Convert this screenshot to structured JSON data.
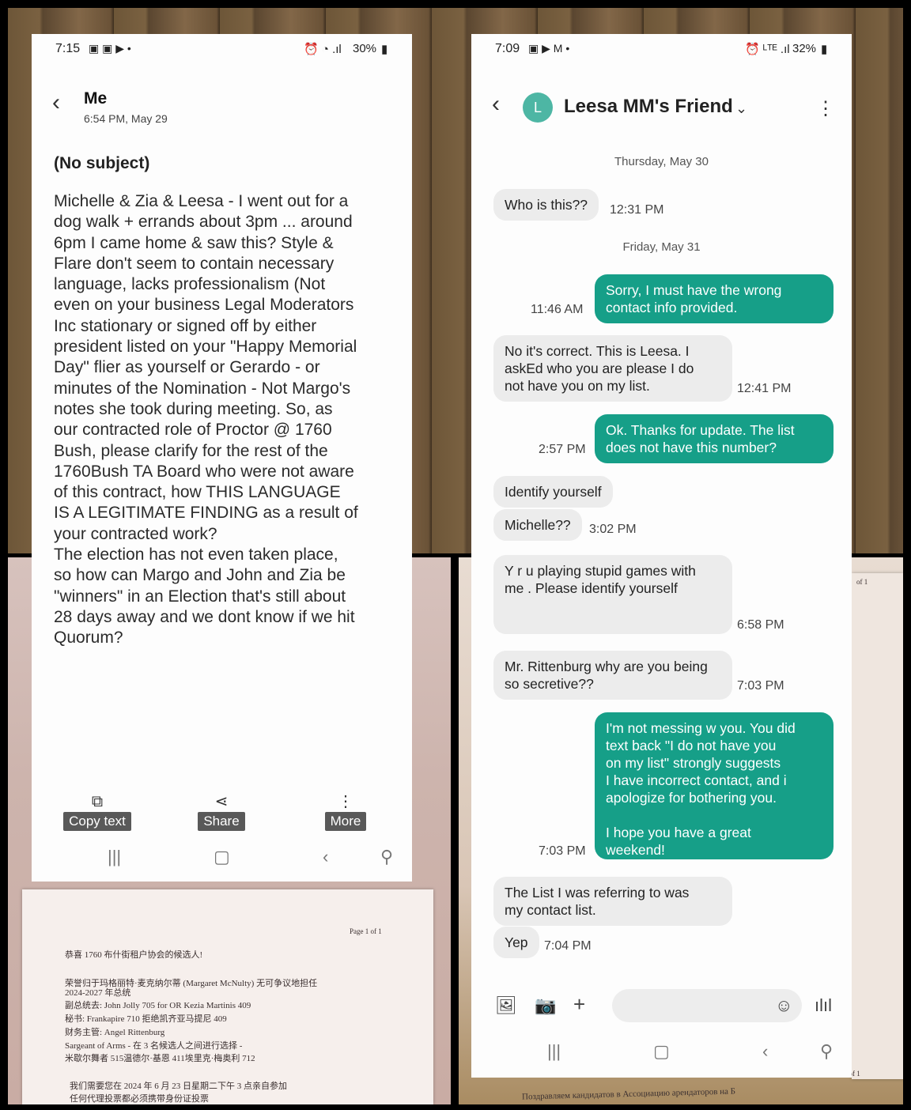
{
  "left_screen": {
    "status": {
      "time": "7:15",
      "battery": "30%"
    },
    "header": {
      "title": "Me",
      "date": "6:54 PM, May 29"
    },
    "subject": "(No subject)",
    "body": "Michelle & Zia & Leesa - I went out for a\ndog walk + errands about 3pm ... around\n6pm I came home & saw this? Style &\nFlare don't seem to contain necessary\nlanguage, lacks professionalism (Not\neven on your business Legal Moderators\nInc stationary or signed off  by either\npresident listed on your \"Happy Memorial\nDay\" flier as yourself or Gerardo - or\nminutes of the Nomination - Not Margo's\nnotes she took during meeting. So, as\nour contracted role of Proctor @ 1760\nBush, please clarify for the rest of the\n1760Bush TA Board who were not aware\nof this contract, how THIS LANGUAGE\nIS A LEGITIMATE FINDING as a result of\nyour contracted work?\nThe election has not even taken place,\nso how can Margo and John and Zia be\n\"winners\" in an Election that's still about\n28 days away and we dont know if we hit\nQuorum?",
    "actions": {
      "copy": "Copy text",
      "share": "Share",
      "more": "More"
    }
  },
  "right_screen": {
    "status": {
      "time": "7:09",
      "battery": "32%"
    },
    "header": {
      "avatar_letter": "L",
      "contact_name": "Leesa MM's Friend"
    },
    "day_separators": {
      "thu": "Thursday, May 30",
      "fri": "Friday, May 31"
    },
    "messages": [
      {
        "dir": "in",
        "text": "Who is this??",
        "time": "12:31 PM"
      },
      {
        "dir": "out",
        "text": "Sorry, I must have the wrong\ncontact info provided.",
        "time": "11:46 AM"
      },
      {
        "dir": "in",
        "text": "No it's correct. This is Leesa. I\naskEd who you are please I do\nnot have you on my list.",
        "time": "12:41 PM"
      },
      {
        "dir": "out",
        "text": "Ok. Thanks for update. The list\ndoes not have this number?",
        "time": "2:57 PM"
      },
      {
        "dir": "in",
        "text": "Identify yourself",
        "time": ""
      },
      {
        "dir": "in",
        "text": "Michelle??",
        "time": "3:02 PM"
      },
      {
        "dir": "in",
        "text": "Y r u playing stupid games with\nme . Please identify yourself",
        "time": "6:58 PM"
      },
      {
        "dir": "in",
        "text": "Mr. Rittenburg why are you being\nso secretive??",
        "time": "7:03 PM"
      },
      {
        "dir": "out",
        "text": "I'm not messing w you. You did\ntext back \"I do not have you\non my list\" strongly suggests\nI have incorrect contact, and i\napologize for bothering you.\n\nI hope you have a great\nweekend!",
        "time": "7:03 PM"
      },
      {
        "dir": "in",
        "text": "The List I was referring to was\nmy contact list.",
        "time": ""
      },
      {
        "dir": "in",
        "text": "Yep",
        "time": "7:04 PM"
      }
    ]
  },
  "background_papers": {
    "left_page_marker": "Page 1 of 1",
    "left_lines": [
      "恭喜 1760 布什街租户协会的候选人!",
      "荣誉归于玛格丽特·麦克纳尔蒂 (Margaret McNulty) 无可争议地担任",
      "2024-2027 年总统",
      "副总统去: John Jolly 705 for OR Kezia Martinis 409",
      "秘书: Frankapire 710 拒绝凯齐亚马提尼 409",
      "财务主管: Angel Rittenburg",
      "Sargeant of Arms - 在 3 名候选人之间进行选择 -",
      "米歇尔舞者 515温德尔·基恩 411埃里克·梅奥利 712",
      "我们需要您在 2024 年 6 月 23 日星期二下午 3 点亲自参加",
      "任何代理投票都必须携带身份证投票"
    ],
    "right_page_marker": "of 1",
    "right_page_marker_2": "Page 1 of 1",
    "right_bottom_line": "Поздравляем кандидатов в Ассоциацию арендаторов на Б"
  }
}
